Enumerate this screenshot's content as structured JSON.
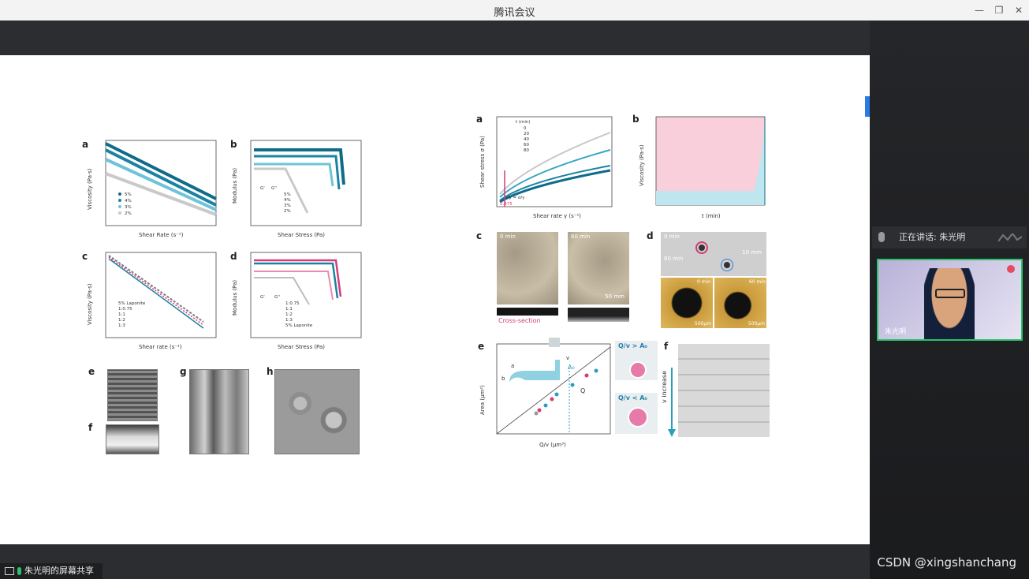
{
  "window": {
    "title": "腾讯会议"
  },
  "sidebar": {
    "speaking_label": "正在讲话: 朱光明",
    "participant_name": "朱光明"
  },
  "share_bar": {
    "label": "朱光明的屏幕共享"
  },
  "watermark": "CSDN @xingshanchang",
  "colors": {
    "accent_green": "#2bc36c",
    "series_dark": "#0e6b8a",
    "series_light": "#6fc3d8",
    "pink": "#d63a78"
  },
  "left_figure": {
    "letters": [
      "a",
      "b",
      "c",
      "d",
      "e",
      "f",
      "g",
      "h"
    ],
    "a": {
      "ylabel": "Viscosity (Pa·s)",
      "xlabel": "Shear Rate (s⁻¹)",
      "legend": [
        "5%",
        "4%",
        "3%",
        "2%"
      ]
    },
    "b": {
      "ylabel": "Modulus (Pa)",
      "xlabel": "Shear Stress (Pa)",
      "legend": [
        "5%",
        "4%",
        "3%",
        "2%"
      ],
      "legend_head": [
        "G'",
        "G''"
      ]
    },
    "c": {
      "ylabel": "Viscosity (Pa·s)",
      "xlabel": "Shear rate (s⁻¹)",
      "legend": [
        "5% Laponite",
        "1:0.75",
        "1:1",
        "1:2",
        "1:3"
      ]
    },
    "d": {
      "ylabel": "Modulus (Pa)",
      "xlabel": "Shear Stress (Pa)",
      "legend": [
        "1:0.75",
        "1:1",
        "1:2",
        "1:3",
        "5% Laponite"
      ],
      "legend_head": [
        "G'",
        "G''"
      ]
    }
  },
  "right_figure": {
    "letters": [
      "a",
      "b",
      "c",
      "d",
      "e",
      "f"
    ],
    "a": {
      "ylabel": "Shear stress σ (Pa)",
      "xlabel": "Shear rate γ (s⁻¹)",
      "legend_title": "t (min)",
      "legend": [
        "0",
        "20",
        "40",
        "60",
        "80"
      ],
      "annotation": "σy = σ/γ",
      "marker": "0.375"
    },
    "b": {
      "ylabel": "Viscosity (Pa·s)",
      "xlabel": "t (min)"
    },
    "c": {
      "labels": [
        "0 min",
        "60 min",
        "50 mm"
      ],
      "sublabel": "Cross-section"
    },
    "d": {
      "labels": [
        "0 min",
        "60 min",
        "10 mm",
        "0 min",
        "60 min",
        "500μm",
        "500μm"
      ]
    },
    "e": {
      "ylabel": "Area (μm²)",
      "xlabel": "Q/v (μm³)",
      "labels": [
        "A₀",
        "Q",
        "a",
        "b",
        "v"
      ],
      "conditions": [
        "Q/v > A₀",
        "Q/v < A₀"
      ]
    },
    "f": {
      "ylabel": "v increase"
    }
  }
}
